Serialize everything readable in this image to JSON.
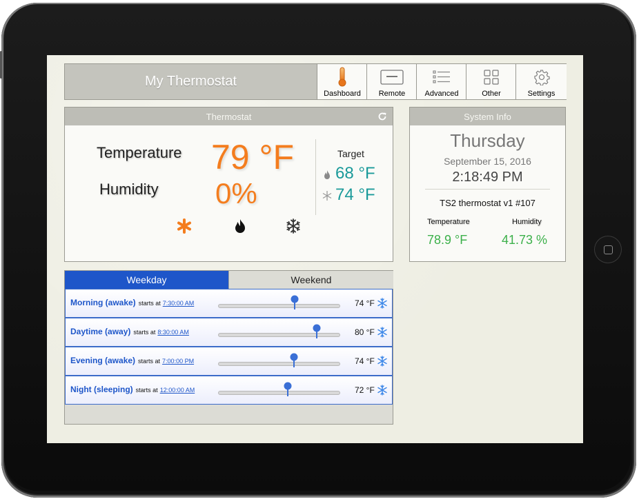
{
  "app": {
    "title": "My Thermostat"
  },
  "nav": [
    {
      "label": "Dashboard",
      "icon": "thermometer-icon"
    },
    {
      "label": "Remote",
      "icon": "remote-icon"
    },
    {
      "label": "Advanced",
      "icon": "list-icon"
    },
    {
      "label": "Other",
      "icon": "grid-icon"
    },
    {
      "label": "Settings",
      "icon": "gear-icon"
    }
  ],
  "thermostat": {
    "header": "Thermostat",
    "temperature_label": "Temperature",
    "temperature_value": "79 °F",
    "humidity_label": "Humidity",
    "humidity_value": "0%",
    "target_label": "Target",
    "target_heat": "68 °F",
    "target_cool": "74 °F",
    "modes": [
      "fan-icon",
      "flame-icon",
      "snowflake-icon"
    ]
  },
  "system_info": {
    "header": "System Info",
    "day": "Thursday",
    "date": "September 15, 2016",
    "time": "2:18:49 PM",
    "device": "TS2 thermostat v1 #107",
    "temperature_label": "Temperature",
    "humidity_label": "Humidity",
    "temperature_value": "78.9 °F",
    "humidity_value": "41.73 %"
  },
  "schedule": {
    "tabs": [
      "Weekday",
      "Weekend"
    ],
    "active_tab": "Weekday",
    "starts_text": "starts at",
    "rows": [
      {
        "name": "Morning (awake)",
        "time": "7:30:00 AM",
        "temp": "74 °F",
        "level": 0.63
      },
      {
        "name": "Daytime (away)",
        "time": "8:30:00 AM",
        "temp": "80 °F",
        "level": 0.81
      },
      {
        "name": "Evening (awake)",
        "time": "7:00:00 PM",
        "temp": "74 °F",
        "level": 0.62
      },
      {
        "name": "Night (sleeping)",
        "time": "12:00:00 AM",
        "temp": "72 °F",
        "level": 0.57
      }
    ]
  },
  "colors": {
    "accent_orange": "#f47d1e",
    "target_teal": "#1a9a9a",
    "info_green": "#3cb04a",
    "tab_blue": "#1e56c9"
  }
}
